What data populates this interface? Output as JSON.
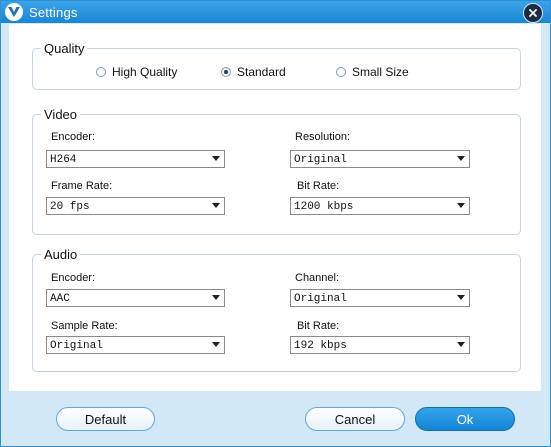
{
  "window": {
    "title": "Settings"
  },
  "quality": {
    "legend": "Quality",
    "options": [
      {
        "label": "High Quality",
        "selected": false
      },
      {
        "label": "Standard",
        "selected": true
      },
      {
        "label": "Small Size",
        "selected": false
      }
    ]
  },
  "video": {
    "legend": "Video",
    "encoder_label": "Encoder:",
    "encoder_value": "H264",
    "resolution_label": "Resolution:",
    "resolution_value": "Original",
    "frame_rate_label": "Frame Rate:",
    "frame_rate_value": "20 fps",
    "bit_rate_label": "Bit Rate:",
    "bit_rate_value": "1200 kbps"
  },
  "audio": {
    "legend": "Audio",
    "encoder_label": "Encoder:",
    "encoder_value": "AAC",
    "channel_label": "Channel:",
    "channel_value": "Original",
    "sample_rate_label": "Sample Rate:",
    "sample_rate_value": "Original",
    "bit_rate_label": "Bit Rate:",
    "bit_rate_value": "192 kbps"
  },
  "buttons": {
    "default": "Default",
    "cancel": "Cancel",
    "ok": "Ok"
  },
  "icons": {
    "logo": "app-logo-icon",
    "close": "close-icon"
  },
  "colors": {
    "titlebar": "#1d86d3",
    "background": "#d3e8f6",
    "ok_button": "#1485d6"
  }
}
